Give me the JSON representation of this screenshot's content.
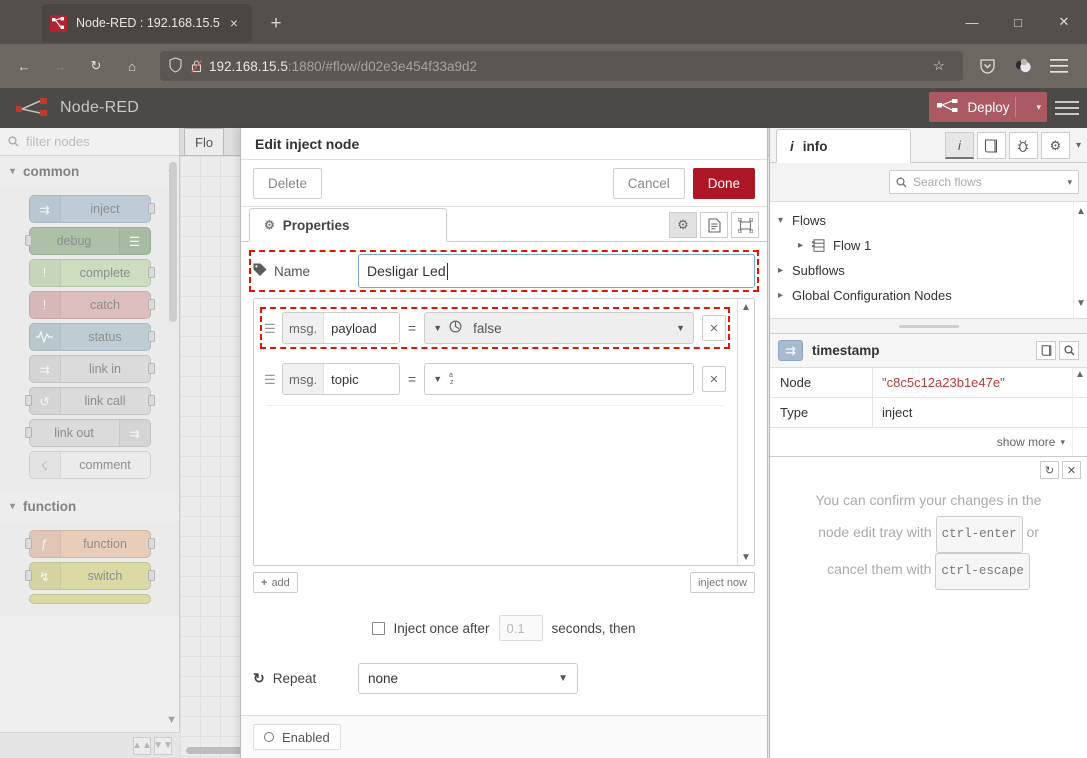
{
  "browser": {
    "tab": {
      "title": "Node-RED : 192.168.15.5",
      "favicon": "node-red-favicon",
      "close": "×"
    },
    "new_tab_label": "+",
    "window_controls": {
      "minimize": "—",
      "maximize": "□",
      "close": "✕"
    },
    "nav": {
      "back": "←",
      "forward": "→",
      "reload": "↻",
      "home": "⌂"
    },
    "url": {
      "host": "192.168.15.5",
      "rest": ":1880/#flow/d02e3e454f33a9d2"
    },
    "url_icons": {
      "shield": "shield-icon",
      "lock": "broken-lock-icon",
      "bookmark": "☆"
    },
    "toolbar_icons": {
      "pocket": "pocket-icon",
      "account": "account-icon",
      "menu": "hamburger-icon"
    }
  },
  "nodered": {
    "brand": "Node-RED",
    "deploy_label": "Deploy",
    "deploy_caret": "▾",
    "deploy_color": "#ab5a63"
  },
  "palette": {
    "search_placeholder": "filter nodes",
    "categories": [
      {
        "name": "common",
        "nodes": [
          {
            "label": "inject",
            "color": "#a6bbcf",
            "icon": "inject-icon",
            "icon_side": "left",
            "ports": [
              "out"
            ]
          },
          {
            "label": "debug",
            "color": "#87a980",
            "icon": "debug-icon",
            "icon_side": "right",
            "ports": [
              "in"
            ]
          },
          {
            "label": "complete",
            "color": "#bcd6a7",
            "icon": "alert-icon",
            "icon_side": "left",
            "ports": [
              "out"
            ]
          },
          {
            "label": "catch",
            "color": "#d8a3a3",
            "icon": "alert-icon",
            "icon_side": "left",
            "ports": [
              "out"
            ]
          },
          {
            "label": "status",
            "color": "#a5bdc7",
            "icon": "status-icon",
            "icon_side": "left",
            "ports": [
              "out"
            ]
          },
          {
            "label": "link in",
            "color": "#d3d3d3",
            "icon": "link-in-icon",
            "icon_side": "left",
            "ports": [
              "out"
            ]
          },
          {
            "label": "link call",
            "color": "#d3d3d3",
            "icon": "link-call-icon",
            "icon_side": "left",
            "ports": [
              "in",
              "out"
            ]
          },
          {
            "label": "link out",
            "color": "#d3d3d3",
            "icon": "link-out-icon",
            "icon_side": "right",
            "ports": [
              "in"
            ]
          },
          {
            "label": "comment",
            "color": "#ededed",
            "icon": "comment-icon",
            "icon_side": "left",
            "ports": []
          }
        ]
      },
      {
        "name": "function",
        "nodes": [
          {
            "label": "function",
            "color": "#e8bca0",
            "icon": "function-icon",
            "icon_side": "left",
            "ports": [
              "in",
              "out"
            ]
          },
          {
            "label": "switch",
            "color": "#d4d17d",
            "icon": "switch-icon",
            "icon_side": "left",
            "ports": [
              "in",
              "out"
            ]
          }
        ]
      }
    ],
    "footer_buttons": [
      "collapse-all-icon",
      "expand-all-icon"
    ]
  },
  "workspace": {
    "tab_label": "Flo"
  },
  "edit_dialog": {
    "title": "Edit inject node",
    "buttons": {
      "delete": "Delete",
      "cancel": "Cancel",
      "done": "Done"
    },
    "tabs": [
      {
        "label": "Properties",
        "icon": "gear-icon"
      }
    ],
    "tab_buttons": [
      "gear-icon",
      "description-icon",
      "appearance-icon"
    ],
    "name_field": {
      "label": "Name",
      "icon": "tag-icon",
      "value": "Desligar Led",
      "highlighted": true
    },
    "properties": [
      {
        "prefix": "msg.",
        "key": "payload",
        "equals": "=",
        "type_icon": "boolean-icon",
        "value": "false",
        "has_dropdown": true,
        "remove": "✕",
        "highlighted": true
      },
      {
        "prefix": "msg.",
        "key": "topic",
        "equals": "=",
        "type_icon": "string-az-icon",
        "value": "",
        "has_dropdown": false,
        "remove": "✕",
        "highlighted": false
      }
    ],
    "add_button": "add",
    "inject_now_button": "inject now",
    "inject_once": {
      "checked": false,
      "text_before": "Inject once after",
      "delay_placeholder": "0.1",
      "text_after": "seconds, then"
    },
    "repeat": {
      "label": "Repeat",
      "icon": "repeat-icon",
      "value": "none"
    },
    "footer": {
      "enabled_label": "Enabled",
      "state_icon": "circle-icon"
    },
    "highlight_color": "#e51400"
  },
  "sidebar": {
    "tab": {
      "label": "info",
      "icon": "info-icon"
    },
    "tab_buttons": [
      {
        "name": "info-icon",
        "active": true
      },
      {
        "name": "help-book-icon",
        "active": false
      },
      {
        "name": "debug-bug-icon",
        "active": false
      },
      {
        "name": "config-gear-icon",
        "active": false
      }
    ],
    "tab_caret": "▾",
    "search": {
      "placeholder": "Search flows",
      "icon": "search-icon",
      "caret": "▾"
    },
    "tree": [
      {
        "label": "Flows",
        "expanded": true,
        "indent": 0,
        "icon": null
      },
      {
        "label": "Flow 1",
        "expanded": false,
        "indent": 1,
        "icon": "flow-icon"
      },
      {
        "label": "Subflows",
        "expanded": false,
        "indent": 0,
        "icon": null
      },
      {
        "label": "Global Configuration Nodes",
        "expanded": false,
        "indent": 0,
        "icon": null
      }
    ],
    "node_panel": {
      "title": "timestamp",
      "icon": "inject-icon",
      "buttons": [
        "help-book-icon",
        "search-icon"
      ],
      "rows": [
        {
          "key": "Node",
          "value": "\"c8c5c12a23b1e47e\"",
          "is_string": true
        },
        {
          "key": "Type",
          "value": "inject",
          "is_string": false
        }
      ],
      "show_more": "show more",
      "show_more_caret": "▾"
    },
    "bottom_panel": {
      "buttons": [
        "refresh-icon",
        "close-icon"
      ],
      "message_parts": {
        "line1": "You can confirm your changes in the",
        "line2_a": "node edit tray with",
        "kbd1": "ctrl-enter",
        "line2_b": "or",
        "line3_a": "cancel them with",
        "kbd2": "ctrl-escape"
      }
    }
  }
}
